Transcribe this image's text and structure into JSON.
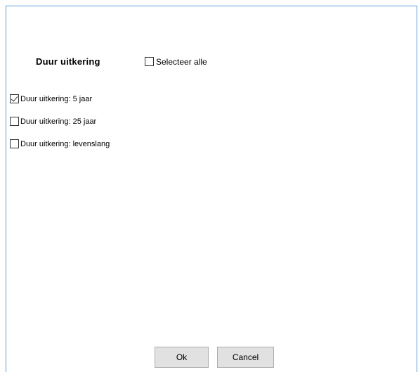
{
  "header": {
    "title": "Duur uitkering",
    "select_all_label": "Selecteer alle",
    "select_all_checked": false
  },
  "options": [
    {
      "label": "Duur uitkering: 5 jaar",
      "checked": true
    },
    {
      "label": "Duur uitkering: 25 jaar",
      "checked": false
    },
    {
      "label": "Duur uitkering: levenslang",
      "checked": false
    }
  ],
  "buttons": {
    "ok_label": "Ok",
    "cancel_label": "Cancel"
  },
  "colors": {
    "frame_border": "#5b9bd5",
    "button_bg": "#e1e1e1"
  }
}
